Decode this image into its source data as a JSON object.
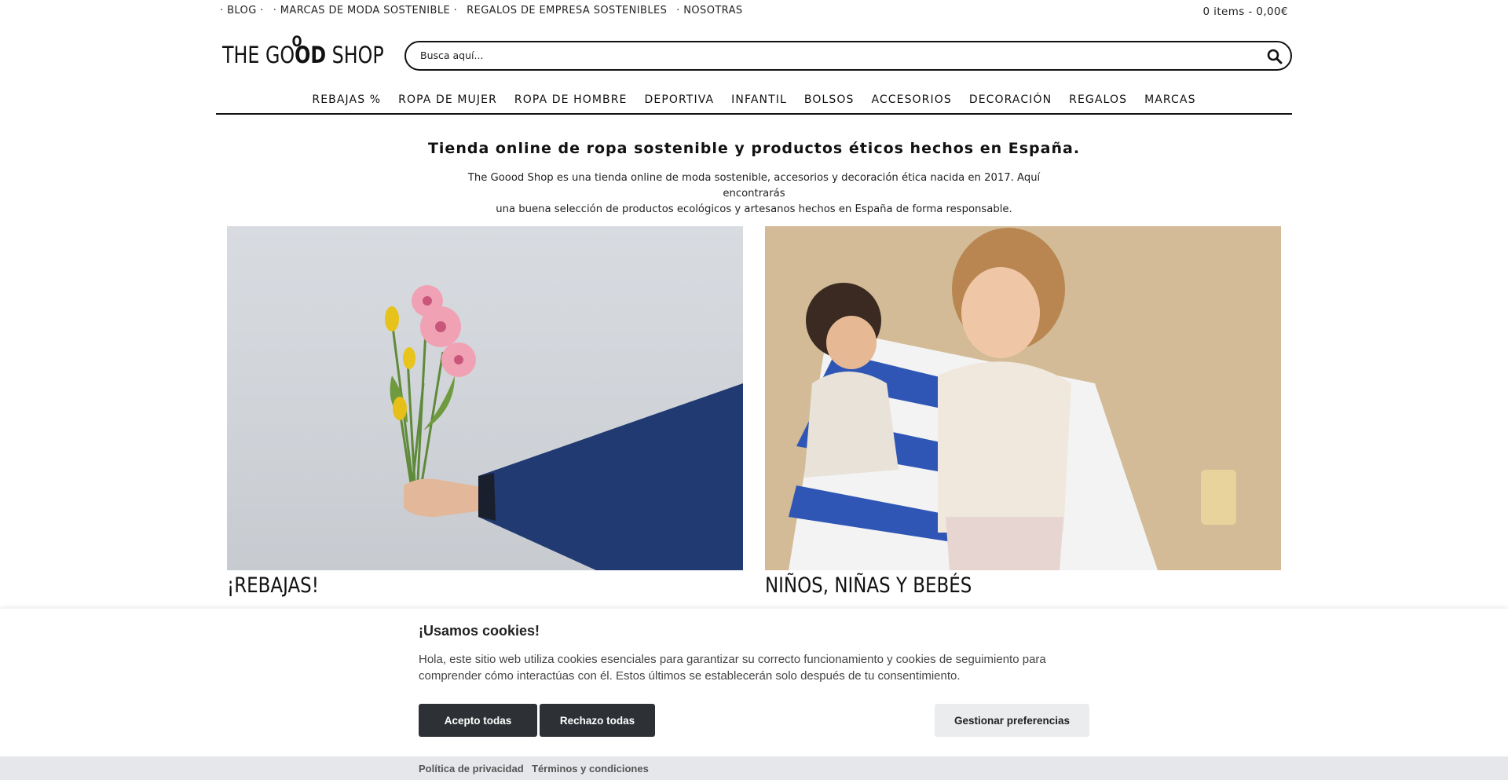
{
  "topbar": {
    "links": [
      "· BLOG ·",
      "· MARCAS DE MODA SOSTENIBLE ·",
      "REGALOS DE EMPRESA SOSTENIBLES",
      "· NOSOTRAS"
    ],
    "cart": "0 items - 0,00€"
  },
  "header": {
    "logo_prefix": "THE GO",
    "logo_bold": "OD",
    "logo_suffix": " SHOP",
    "logo_top_o": "O",
    "search_placeholder": "Busca aquí..."
  },
  "nav": {
    "items": [
      "REBAJAS %",
      "ROPA DE MUJER",
      "ROPA DE HOMBRE",
      "DEPORTIVA",
      "INFANTIL",
      "BOLSOS",
      "ACCESORIOS",
      "DECORACIÓN",
      "REGALOS",
      "MARCAS"
    ]
  },
  "intro": {
    "title": "Tienda online de ropa sostenible y productos éticos hechos en España.",
    "line1": "The Goood Shop es una tienda online de moda sostenible, accesorios y decoración ética nacida en 2017. Aquí encontrarás",
    "line2": "una buena selección de productos ecológicos y artesanos hechos en España de forma responsable."
  },
  "tiles": [
    {
      "caption": "¡REBAJAS!"
    },
    {
      "caption": "NIÑOS, NIÑAS Y BEBÉS"
    }
  ],
  "cookie": {
    "title": "¡Usamos cookies!",
    "text": "Hola, este sitio web utiliza cookies esenciales para garantizar su correcto funcionamiento y cookies de seguimiento para comprender cómo interactúas con él. Estos últimos se establecerán solo después de tu consentimiento.",
    "accept": "Acepto todas",
    "reject": "Rechazo todas",
    "prefs": "Gestionar preferencias",
    "privacy": "Política de privacidad",
    "terms": "Términos y condiciones"
  }
}
